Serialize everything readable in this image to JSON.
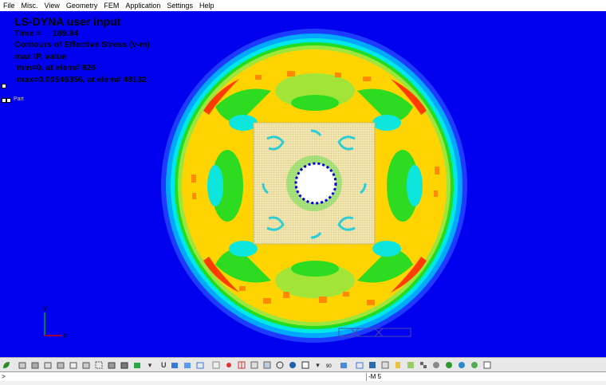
{
  "menu": [
    "File",
    "Misc.",
    "View",
    "Geometry",
    "FEM",
    "Application",
    "Settings",
    "Help"
  ],
  "overlay": {
    "title": "LS-DYNA user input",
    "time": "Time =     189.94",
    "contours": "Contours of Effective Stress (v-m)",
    "max_ip": "max IP. value",
    "min": " min=0, at elem# 826",
    "max": " max=0.00546356, at elem# 48132"
  },
  "left_marker_label": "Part",
  "axis": {
    "x": "X",
    "y": "Y"
  },
  "toolbar": {
    "u_label": "U",
    "m5_label": "-M 5"
  },
  "command": {
    "prompt": ">",
    "value": ">",
    "right": "-M 5"
  },
  "colors": {
    "background": "#0000ee",
    "blue": "#0000ee",
    "light_blue": "#00a8ff",
    "cyan": "#00e8e8",
    "green": "#22dd22",
    "light_green": "#9ee63c",
    "yellow": "#ffd400",
    "orange": "#ff8a00",
    "red": "#ff3d00"
  }
}
